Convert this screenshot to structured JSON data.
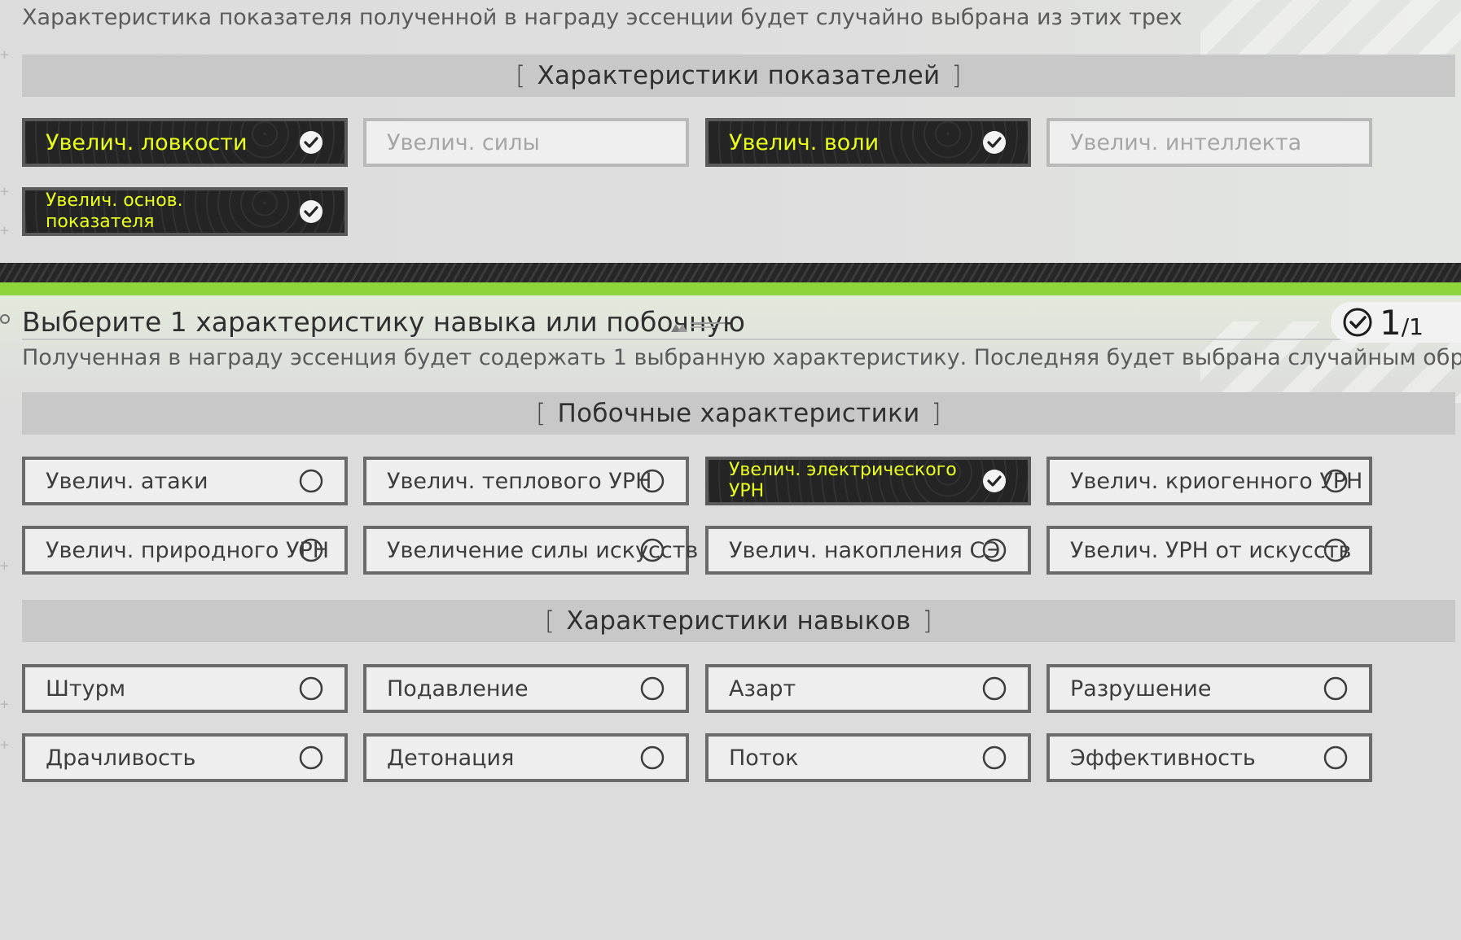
{
  "top": {
    "description": "Характеристика показателя полученной в награду эссенции будет случайно выбрана из этих трех",
    "header": "Характеристики показателей",
    "cards": [
      {
        "label": "Увелич. ловкости",
        "state": "selected"
      },
      {
        "label": "Увелич. силы",
        "state": "disabled"
      },
      {
        "label": "Увелич. воли",
        "state": "selected"
      },
      {
        "label": "Увелич. интеллекта",
        "state": "disabled"
      },
      {
        "label": "Увелич. основ. показателя",
        "state": "selected"
      }
    ]
  },
  "bottom": {
    "title": "Выберите 1 характеристику навыка или побочную",
    "counter_current": "1",
    "counter_total": "/1",
    "description": "Полученная в награду эссенция будет содержать 1 выбранную характеристику. Последняя будет выбрана случайным образом.",
    "secondary_header": "Побочные характеристики",
    "secondary": [
      {
        "label": "Увелич. атаки",
        "state": "unselected"
      },
      {
        "label": "Увелич. теплового УРН",
        "state": "unselected"
      },
      {
        "label": "Увелич. электрического УРН",
        "state": "selected"
      },
      {
        "label": "Увелич. криогенного УРН",
        "state": "unselected"
      },
      {
        "label": "Увелич. природного УРН",
        "state": "unselected"
      },
      {
        "label": "Увеличение силы искусств",
        "state": "unselected"
      },
      {
        "label": "Увелич. накопления СЭ",
        "state": "unselected"
      },
      {
        "label": "Увелич. УРН от искусств",
        "state": "unselected"
      }
    ],
    "skill_header": "Характеристики навыков",
    "skills": [
      {
        "label": "Штурм",
        "state": "unselected"
      },
      {
        "label": "Подавление",
        "state": "unselected"
      },
      {
        "label": "Азарт",
        "state": "unselected"
      },
      {
        "label": "Разрушение",
        "state": "unselected"
      },
      {
        "label": "Драчливость",
        "state": "unselected"
      },
      {
        "label": "Детонация",
        "state": "unselected"
      },
      {
        "label": "Поток",
        "state": "unselected"
      },
      {
        "label": "Эффективность",
        "state": "unselected"
      }
    ]
  },
  "colors": {
    "accent_text": "#e9ff1a",
    "selected_bg": "#242424",
    "green_bar": "#8dd43d"
  },
  "icons": {
    "selected": "check-circle-icon",
    "unselected": "radio-circle-icon",
    "counter": "check-circle-icon"
  }
}
